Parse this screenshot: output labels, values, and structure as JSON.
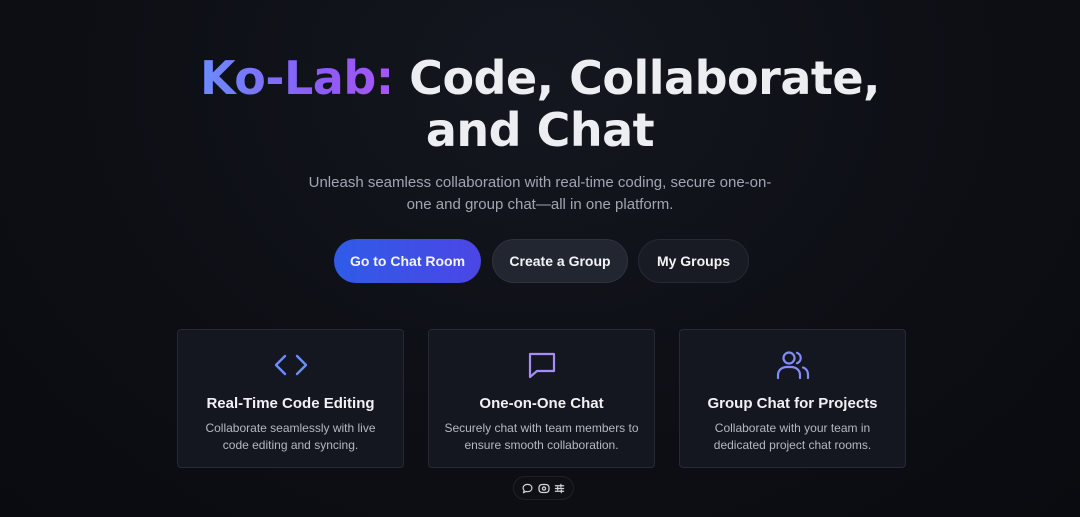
{
  "hero": {
    "brand": "Ko-Lab:",
    "title_line1_rest": " Code, Collaborate,",
    "title_line2": "and Chat",
    "subtitle": "Unleash seamless collaboration with real-time coding, secure one-on-one and group chat—all in one platform."
  },
  "actions": {
    "chat_room": "Go to Chat Room",
    "create_group": "Create a Group",
    "my_groups": "My Groups"
  },
  "features": [
    {
      "icon": "code-icon",
      "title": "Real-Time Code Editing",
      "description": "Collaborate seamlessly with live code editing and syncing."
    },
    {
      "icon": "chat-bubble-icon",
      "title": "One-on-One Chat",
      "description": "Securely chat with team members to ensure smooth collaboration."
    },
    {
      "icon": "users-icon",
      "title": "Group Chat for Projects",
      "description": "Collaborate with your team in dedicated project chat rooms."
    }
  ],
  "toolbar": {
    "icons": [
      "comment-icon",
      "eye-icon",
      "sliders-icon"
    ]
  },
  "colors": {
    "background": "#0c0e14",
    "brand_gradient_start": "#6b8cff",
    "brand_gradient_end": "#a855f7",
    "primary_button": "#2f5be8",
    "icon_blue": "#6b8cff",
    "icon_purple": "#a78bfa",
    "icon_indigo": "#818cf8"
  }
}
